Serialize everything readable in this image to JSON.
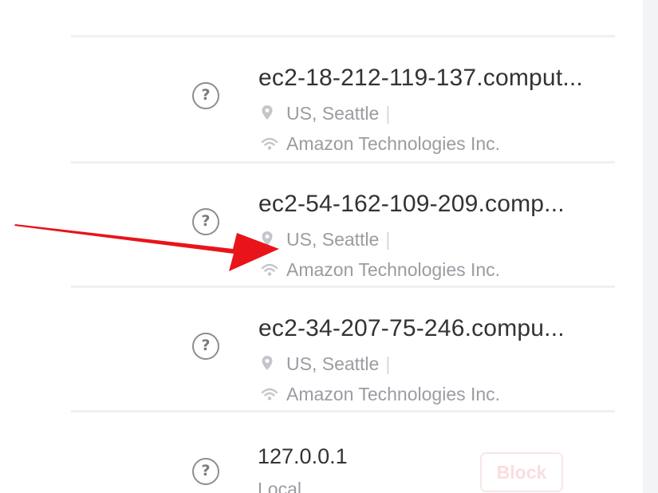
{
  "connections": [
    {
      "status_icon": "question-circle-icon",
      "status_glyph": "?",
      "hostname": "ec2-18-212-119-137.comput...",
      "location": "US, Seattle",
      "location_separator": "|",
      "organization": "Amazon Technologies Inc."
    },
    {
      "status_icon": "question-circle-icon",
      "status_glyph": "?",
      "hostname": "ec2-54-162-109-209.comp...",
      "location": "US, Seattle",
      "location_separator": "|",
      "organization": "Amazon Technologies Inc."
    },
    {
      "status_icon": "question-circle-icon",
      "status_glyph": "?",
      "hostname": "ec2-34-207-75-246.compu...",
      "location": "US, Seattle",
      "location_separator": "|",
      "organization": "Amazon Technologies Inc."
    }
  ],
  "local_connection": {
    "status_icon": "question-circle-icon",
    "status_glyph": "?",
    "address": "127.0.0.1",
    "label": "Local",
    "block_label": "Block"
  },
  "colors": {
    "annotation_arrow": "#e8141a",
    "hostname_text": "#333336",
    "meta_text": "#9a9ca2",
    "block_button_text": "#f9dede",
    "divider": "#f0f0f2"
  },
  "icons": {
    "location": "map-pin-icon",
    "network": "wifi-icon",
    "annotation": "red-arrow-icon"
  }
}
